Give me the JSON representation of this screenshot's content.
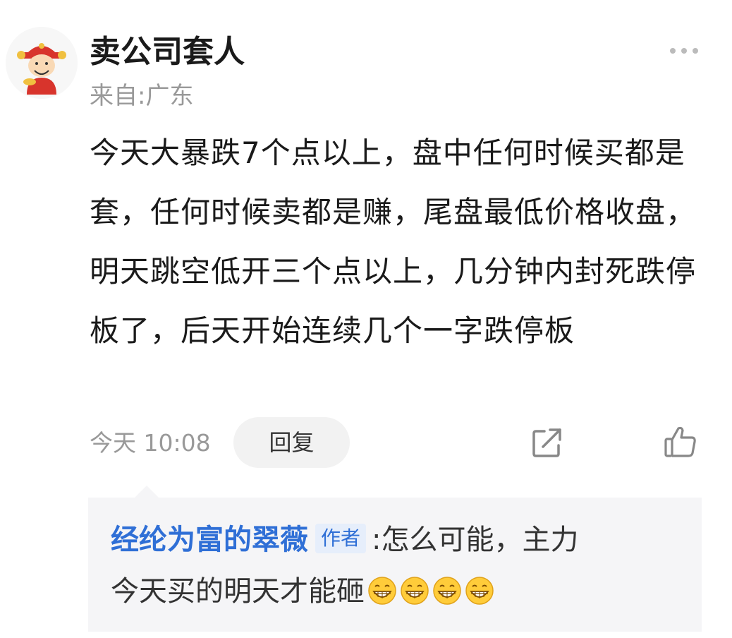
{
  "post": {
    "username": "卖公司套人",
    "location": "来自:广东",
    "avatar_icon": "caishen-avatar-icon",
    "content": "今天大暴跌7个点以上，盘中任何时候买都是套，任何时候卖都是赚，尾盘最低价格收盘，明天跳空低开三个点以上，几分钟内封死跌停板了，后天开始连续几个一字跌停板",
    "time": "今天 10:08",
    "reply_label": "回复",
    "more_icon": "more-dots-icon",
    "share_icon": "share-icon",
    "like_icon": "thumbs-up-icon"
  },
  "reply": {
    "author": "经纶为富的翠薇",
    "badge": "作者",
    "separator": ":",
    "text_part1": "怎么可能，主力",
    "text_part2": "今天买的明天才能砸",
    "emoji_icon": "grinning-face-icon",
    "emoji_count": 4
  },
  "colors": {
    "accent_blue": "#2f6fd6",
    "text_primary": "#1a1a1a",
    "text_secondary": "#999999",
    "reply_bg": "#f5f5f7"
  }
}
